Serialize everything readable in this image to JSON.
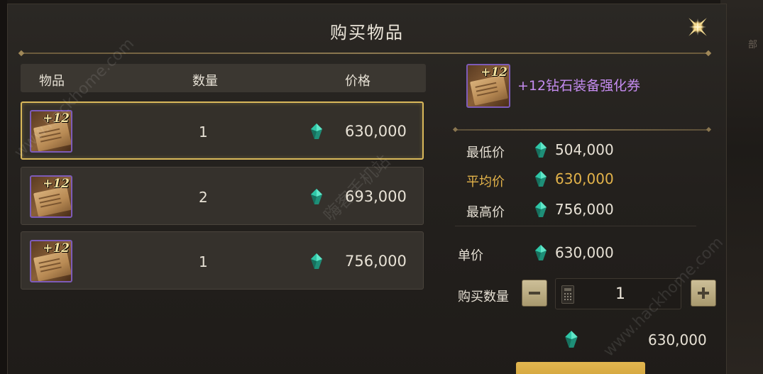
{
  "dialog": {
    "title": "购买物品"
  },
  "table": {
    "headers": {
      "item": "物品",
      "quantity": "数量",
      "price": "价格"
    },
    "rows": [
      {
        "badge": "+12",
        "quantity": "1",
        "price": "630,000",
        "selected": true
      },
      {
        "badge": "+12",
        "quantity": "2",
        "price": "693,000",
        "selected": false
      },
      {
        "badge": "+12",
        "quantity": "1",
        "price": "756,000",
        "selected": false
      }
    ]
  },
  "detail": {
    "badge": "+12",
    "item_name": "+12钻石装备强化券",
    "min_label": "最低价",
    "min_value": "504,000",
    "avg_label": "平均价",
    "avg_value": "630,000",
    "max_label": "最高价",
    "max_value": "756,000",
    "unit_label": "单价",
    "unit_value": "630,000",
    "buy_qty_label": "购买数量",
    "buy_qty_value": "1",
    "total_value": "630,000"
  },
  "background": {
    "side_text": "部"
  },
  "watermarks": {
    "left": "www.hackhome.com",
    "center": "嗨客手机站",
    "right": "www.hackhome.com"
  },
  "colors": {
    "selected_border": "#d9b85a",
    "avg_price": "#e3b34a",
    "item_name": "#c58cf0",
    "buy_button": "#d4a63e",
    "icon_border": "#7d5bb8",
    "gem": "#2fc7a8"
  },
  "icons": {
    "close": "close-star-icon",
    "currency": "gem-icon",
    "minus": "minus-icon",
    "plus": "plus-icon",
    "calculator": "calculator-icon",
    "item": "enhancement-scroll-icon"
  }
}
